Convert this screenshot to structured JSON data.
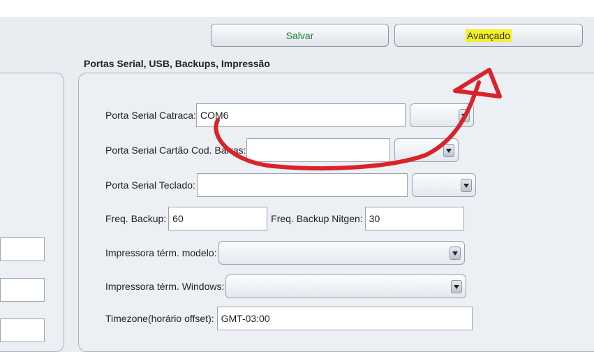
{
  "toolbar": {
    "save_label": "Salvar",
    "advanced_label": "Avançado"
  },
  "section": {
    "title": "Portas Serial, USB, Backups, Impressão"
  },
  "form": {
    "serial_catraca": {
      "label": "Porta Serial Catraca:",
      "value": "COM6"
    },
    "serial_cartao": {
      "label": "Porta Serial Cartão Cod. Barras:",
      "value": ""
    },
    "serial_teclado": {
      "label": "Porta Serial Teclado:",
      "value": ""
    },
    "freq_backup": {
      "label": "Freq. Backup:",
      "value": "60"
    },
    "freq_backup_nitgen": {
      "label": "Freq. Backup Nitgen:",
      "value": "30"
    },
    "impressora_modelo": {
      "label": "Impressora térm. modelo:",
      "value": ""
    },
    "impressora_windows": {
      "label": "Impressora térm. Windows:",
      "value": ""
    },
    "timezone": {
      "label": "Timezone(horário offset):",
      "value": "GMT-03:00"
    }
  },
  "colors": {
    "save_text": "#1e7d33",
    "highlight": "#f5ef2a",
    "annotation": "#d8232a"
  },
  "icons": {
    "combo_arrow": "chevron-down-icon"
  }
}
